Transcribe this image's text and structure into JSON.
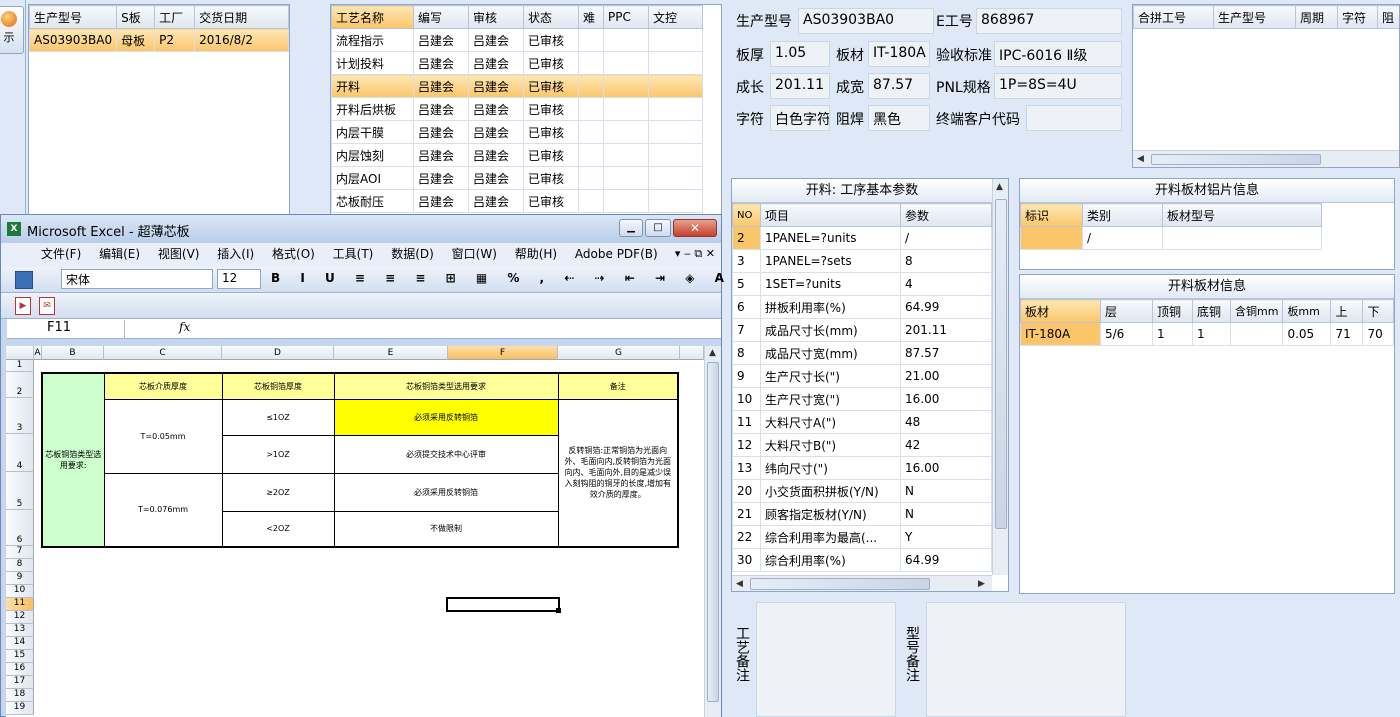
{
  "left_btn": {
    "label": "示"
  },
  "orders": {
    "headers": [
      "生产型号",
      "S板",
      "工厂",
      "交货日期"
    ],
    "rows": [
      [
        "AS03903BA0",
        "母板",
        "P2",
        "2016/8/2"
      ]
    ]
  },
  "processes": {
    "headers": [
      "工艺名称",
      "编写",
      "审核",
      "状态",
      "难",
      "PPC",
      "文控"
    ],
    "rows": [
      [
        "流程指示",
        "吕建会",
        "吕建会",
        "已审核",
        "",
        "",
        ""
      ],
      [
        "计划投料",
        "吕建会",
        "吕建会",
        "已审核",
        "",
        "",
        ""
      ],
      [
        "开料",
        "吕建会",
        "吕建会",
        "已审核",
        "",
        "",
        ""
      ],
      [
        "开料后烘板",
        "吕建会",
        "吕建会",
        "已审核",
        "",
        "",
        ""
      ],
      [
        "内层干膜",
        "吕建会",
        "吕建会",
        "已审核",
        "",
        "",
        ""
      ],
      [
        "内层蚀刻",
        "吕建会",
        "吕建会",
        "已审核",
        "",
        "",
        ""
      ],
      [
        "内层AOI",
        "吕建会",
        "吕建会",
        "已审核",
        "",
        "",
        ""
      ],
      [
        "芯板耐压",
        "吕建会",
        "吕建会",
        "已审核",
        "",
        "",
        ""
      ]
    ]
  },
  "info": {
    "model_label": "生产型号",
    "model": "AS03903BA0",
    "e_label": "E工号",
    "e_value": "868967",
    "thick_label": "板厚",
    "thick": "1.05",
    "mat_label": "板材",
    "mat": "IT-180A",
    "std_label": "验收标准",
    "std": "IPC-6016 Ⅱ级",
    "len_label": "成长",
    "len": "201.11",
    "wid_label": "成宽",
    "wid": "87.57",
    "pnl_label": "PNL规格",
    "pnl": "1P=8S=4U",
    "char_label": "字符",
    "char": "白色字符",
    "mask_label": "阻焊",
    "mask": "黑色",
    "cust_label": "终端客户代码",
    "cust": ""
  },
  "combine": {
    "headers": [
      "合拼工号",
      "生产型号",
      "周期",
      "字符",
      "阻"
    ]
  },
  "params": {
    "title": "开料: 工序基本参数",
    "headers": [
      "NO",
      "项目",
      "参数"
    ],
    "rows": [
      [
        "2",
        "1PANEL=?units",
        "/"
      ],
      [
        "3",
        "1PANEL=?sets",
        "8"
      ],
      [
        "5",
        "1SET=?units",
        "4"
      ],
      [
        "6",
        "拼板利用率(%)",
        "64.99"
      ],
      [
        "7",
        "成品尺寸长(mm)",
        "201.11"
      ],
      [
        "8",
        "成品尺寸宽(mm)",
        "87.57"
      ],
      [
        "9",
        "生产尺寸长(\")",
        "21.00"
      ],
      [
        "10",
        "生产尺寸宽(\")",
        "16.00"
      ],
      [
        "11",
        "大料尺寸A(\")",
        "48"
      ],
      [
        "12",
        "大料尺寸B(\")",
        "42"
      ],
      [
        "13",
        "纬向尺寸(\")",
        "16.00"
      ],
      [
        "20",
        "小交货面积拼板(Y/N)",
        "N"
      ],
      [
        "21",
        "顾客指定板材(Y/N)",
        "N"
      ],
      [
        "22",
        "综合利用率为最高(...",
        "Y"
      ],
      [
        "30",
        "综合利用率(%)",
        "64.99"
      ]
    ]
  },
  "foil": {
    "title": "开料板材铝片信息",
    "headers": [
      "标识",
      "类别",
      "板材型号"
    ],
    "rows": [
      [
        "",
        "/",
        ""
      ]
    ]
  },
  "board": {
    "title": "开料板材信息",
    "headers": [
      "板材",
      "层",
      "顶铜",
      "底铜",
      "含铜mm",
      "板mm",
      "上",
      "下"
    ],
    "rows": [
      [
        "IT-180A",
        "5/6",
        "1",
        "1",
        "",
        "0.05",
        "71",
        "70"
      ]
    ]
  },
  "notes": {
    "craft": "工艺备注",
    "model": "型号备注"
  },
  "excel": {
    "title": "Microsoft Excel - 超薄芯板",
    "menu": [
      "文件(F)",
      "编辑(E)",
      "视图(V)",
      "插入(I)",
      "格式(O)",
      "工具(T)",
      "数据(D)",
      "窗口(W)",
      "帮助(H)",
      "Adobe PDF(B)"
    ],
    "font": "宋体",
    "size": "12",
    "namebox": "F11",
    "fx": "fx",
    "cols": [
      "A",
      "B",
      "C",
      "D",
      "E",
      "F",
      "G"
    ],
    "rows": [
      "1",
      "2",
      "3",
      "4",
      "5",
      "6",
      "7",
      "8",
      "9",
      "10",
      "11",
      "12",
      "13",
      "14",
      "15",
      "16",
      "17",
      "18",
      "19"
    ],
    "t_h1": "芯板介质厚度",
    "t_h2": "芯板铜箔厚度",
    "t_h3": "芯板铜箔类型选用要求",
    "t_h4": "备注",
    "t_side": "芯板铜箔类型选用要求:",
    "t_c1": "T=0.05mm",
    "t_c2": "T=0.076mm",
    "t_d1": "≤1OZ",
    "t_d2": ">1OZ",
    "t_d3": "≥2OZ",
    "t_d4": "<2OZ",
    "t_e1": "必须采用反转铜箔",
    "t_e2": "必须提交技术中心评审",
    "t_e3": "必须采用反转铜箔",
    "t_e4": "不做限制",
    "t_note": "反转铜箔:正常铜箔为光面向外、毛面向内,反转铜箔为光面向内、毛面向外,目的是减少误入刻钩阻的铜牙的长度,增加有效介质的厚度。"
  }
}
